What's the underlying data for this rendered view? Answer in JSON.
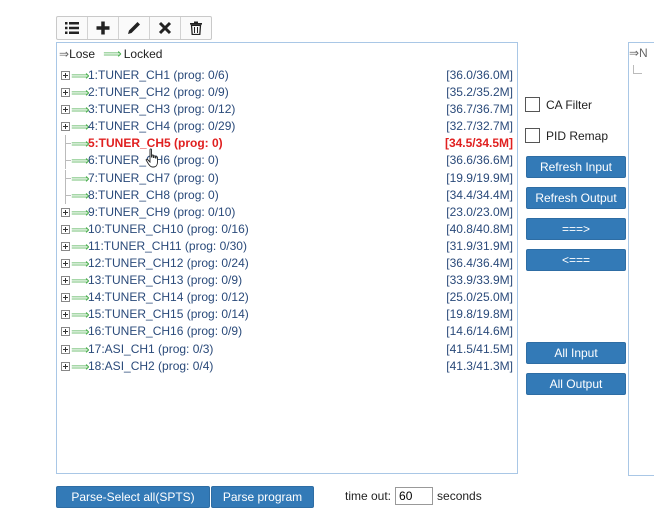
{
  "toolbar": {
    "icons": [
      "list-icon",
      "plus-icon",
      "pencil-icon",
      "close-icon",
      "trash-icon"
    ]
  },
  "legend": {
    "lose_arrow": "⇒",
    "lose_label": "Lose",
    "locked_arrow": "⟹",
    "locked_label": "Locked"
  },
  "channels": [
    {
      "label": "1:TUNER_CH1 (prog: 0/6)",
      "rate": "[36.0/36.0M]",
      "expandable": true
    },
    {
      "label": "2:TUNER_CH2 (prog: 0/9)",
      "rate": "[35.2/35.2M]",
      "expandable": true
    },
    {
      "label": "3:TUNER_CH3 (prog: 0/12)",
      "rate": "[36.7/36.7M]",
      "expandable": true
    },
    {
      "label": "4:TUNER_CH4 (prog: 0/29)",
      "rate": "[32.7/32.7M]",
      "expandable": true
    },
    {
      "label": "5:TUNER_CH5 (prog: 0)",
      "rate": "[34.5/34.5M]",
      "expandable": false,
      "selected": true
    },
    {
      "label": "6:TUNER_CH6 (prog: 0)",
      "rate": "[36.6/36.6M]",
      "expandable": false
    },
    {
      "label": "7:TUNER_CH7 (prog: 0)",
      "rate": "[19.9/19.9M]",
      "expandable": false
    },
    {
      "label": "8:TUNER_CH8 (prog: 0)",
      "rate": "[34.4/34.4M]",
      "expandable": false
    },
    {
      "label": "9:TUNER_CH9 (prog: 0/10)",
      "rate": "[23.0/23.0M]",
      "expandable": true
    },
    {
      "label": "10:TUNER_CH10 (prog: 0/16)",
      "rate": "[40.8/40.8M]",
      "expandable": true
    },
    {
      "label": "11:TUNER_CH11 (prog: 0/30)",
      "rate": "[31.9/31.9M]",
      "expandable": true
    },
    {
      "label": "12:TUNER_CH12 (prog: 0/24)",
      "rate": "[36.4/36.4M]",
      "expandable": true
    },
    {
      "label": "13:TUNER_CH13 (prog: 0/9)",
      "rate": "[33.9/33.9M]",
      "expandable": true
    },
    {
      "label": "14:TUNER_CH14 (prog: 0/12)",
      "rate": "[25.0/25.0M]",
      "expandable": true
    },
    {
      "label": "15:TUNER_CH15 (prog: 0/14)",
      "rate": "[19.8/19.8M]",
      "expandable": true
    },
    {
      "label": "16:TUNER_CH16 (prog: 0/9)",
      "rate": "[14.6/14.6M]",
      "expandable": true
    },
    {
      "label": "17:ASI_CH1 (prog: 0/3)",
      "rate": "[41.5/41.5M]",
      "expandable": true
    },
    {
      "label": "18:ASI_CH2 (prog: 0/4)",
      "rate": "[41.3/41.3M]",
      "expandable": true
    }
  ],
  "options": {
    "ca_filter_label": "CA Filter",
    "pid_remap_label": "PID Remap"
  },
  "buttons": {
    "refresh_input": "Refresh Input",
    "refresh_output": "Refresh Output",
    "move_right": "===>",
    "move_left": "<===",
    "all_input": "All Input",
    "all_output": "All Output",
    "parse_select_all": "Parse-Select all(SPTS)",
    "parse_program": "Parse program"
  },
  "timeout": {
    "label": "time out:",
    "value": "60",
    "unit": "seconds"
  },
  "right_panel": {
    "header": "⇒N"
  },
  "colors": {
    "button_blue": "#337ab7",
    "locked_green": "#4caf50",
    "selected_red": "#e02020",
    "text_blue": "#2a4a7a"
  }
}
